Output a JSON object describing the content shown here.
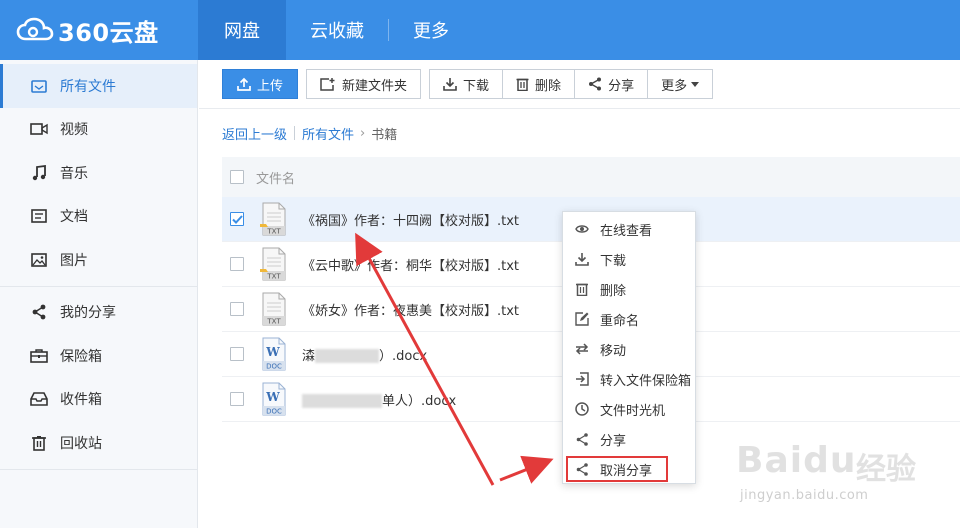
{
  "brand": {
    "logo_text": "360云盘"
  },
  "topnav": [
    {
      "label": "网盘",
      "active": true
    },
    {
      "label": "云收藏",
      "active": false
    },
    {
      "label": "更多",
      "active": false
    }
  ],
  "sidebar": {
    "items": [
      {
        "label": "所有文件",
        "icon": "folder-icon",
        "active": true
      },
      {
        "label": "视频",
        "icon": "video-icon"
      },
      {
        "label": "音乐",
        "icon": "music-icon"
      },
      {
        "label": "文档",
        "icon": "document-icon"
      },
      {
        "label": "图片",
        "icon": "image-icon"
      },
      {
        "label": "我的分享",
        "icon": "share-icon"
      },
      {
        "label": "保险箱",
        "icon": "safe-icon"
      },
      {
        "label": "收件箱",
        "icon": "inbox-icon"
      },
      {
        "label": "回收站",
        "icon": "trash-icon"
      }
    ]
  },
  "toolbar": {
    "upload": "上传",
    "new_folder": "新建文件夹",
    "download": "下载",
    "delete": "删除",
    "share": "分享",
    "more": "更多"
  },
  "breadcrumb": {
    "back": "返回上一级",
    "root": "所有文件",
    "current": "书籍"
  },
  "table": {
    "header": "文件名"
  },
  "files": [
    {
      "name": "《祸国》作者：十四阙【校对版】.txt",
      "type": "TXT",
      "checked": true
    },
    {
      "name": "《云中歌》作者：桐华【校对版】.txt",
      "type": "TXT",
      "checked": false
    },
    {
      "name": "《娇女》作者：夜惠美【校对版】.txt",
      "type": "TXT",
      "checked": false
    },
    {
      "name_prefix": "潹",
      "name_suffix": "）.docx",
      "type": "DOC",
      "checked": false
    },
    {
      "name_prefix": "",
      "name_suffix": "单人）.docx",
      "type": "DOC",
      "checked": false
    }
  ],
  "context_menu": [
    {
      "label": "在线查看",
      "icon": "eye-icon"
    },
    {
      "label": "下载",
      "icon": "download-icon"
    },
    {
      "label": "删除",
      "icon": "trash-icon"
    },
    {
      "label": "重命名",
      "icon": "edit-icon"
    },
    {
      "label": "移动",
      "icon": "move-icon"
    },
    {
      "label": "转入文件保险箱",
      "icon": "safe-transfer-icon"
    },
    {
      "label": "文件时光机",
      "icon": "clock-icon"
    },
    {
      "label": "分享",
      "icon": "share-icon"
    },
    {
      "label": "取消分享",
      "icon": "share-icon"
    }
  ],
  "watermark": {
    "logo": "Baidu",
    "cn": "经验",
    "url": "jingyan.baidu.com"
  },
  "colors": {
    "brand_blue": "#3a8ee6",
    "annotation_red": "#e23a3a"
  }
}
